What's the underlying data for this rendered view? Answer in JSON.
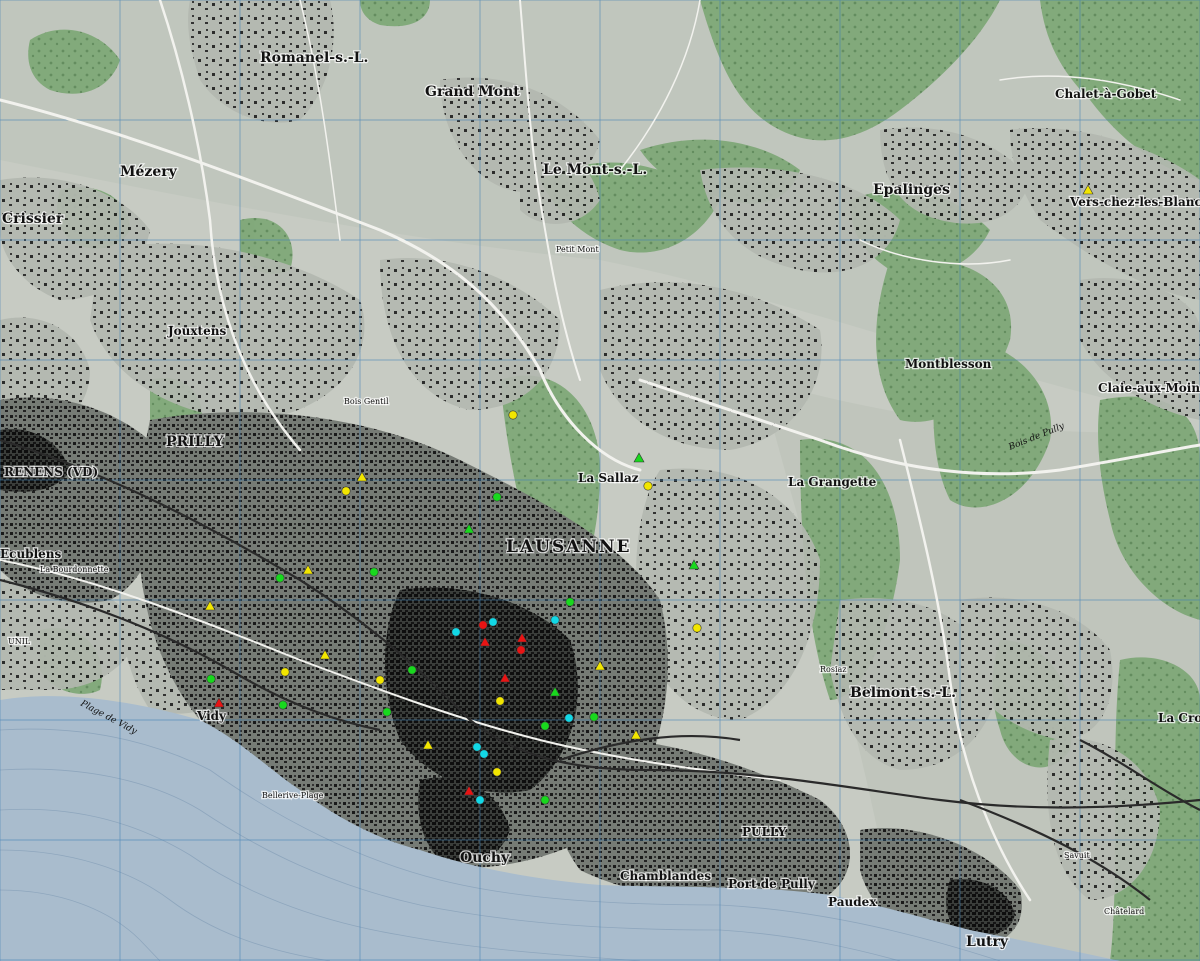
{
  "map": {
    "colors": {
      "lake": "#a9bccd",
      "terrain": "#c7cbc3",
      "forest": "#7fa878",
      "urban": "#6f746f",
      "building": "#111111",
      "grid": "#3f7fb5",
      "road": "#f2f2ee",
      "rail": "#2a2a2a",
      "marker_yellow": "#f2e600",
      "marker_green": "#19d81e",
      "marker_cyan": "#12d8e6",
      "marker_red": "#e81414"
    },
    "places": {
      "lausanne": "LAUSANNE",
      "romanel": "Romanel-s.-L.",
      "le_mont": "Le Mont-s.-L.",
      "grand_mont": "Grand Mont",
      "epalinges": "Epalinges",
      "vers_chez_les_blanc": "Vers-chez-les-Blanc",
      "chalet_a_gobet": "Chalet-à-Gobet",
      "mezery": "Mézery",
      "crissier": "Crissier",
      "jouxtens": "Jouxtens",
      "prilly": "PRILLY",
      "renens": "RENENS (VD)",
      "ecublens": "Ecublens",
      "ouchy": "Ouchy",
      "pully": "PULLY",
      "belmont": "Belmont-s.-L.",
      "lutry": "Lutry",
      "paudex": "Paudex",
      "vidy": "Vidy",
      "monthblesson": "Montblesson",
      "la_sallaz": "La Sallaz",
      "chamblandes": "Chamblandes",
      "port_de_pully": "Port de Pully",
      "plage_de_vidy": "Plage de Vidy",
      "rosiaz": "Rosiaz",
      "savuit": "Savuit",
      "chatelard": "Châtelard",
      "petit_mont": "Petit Mont",
      "la_croix": "La Croix",
      "bellerive": "Bellerive-Plage",
      "la_grangette": "La Grangette",
      "bois_gentil": "Bois Gentil",
      "la_bourdonnette": "La Bourdonnette",
      "unil": "UNIL",
      "bois_du_pully": "Bois de Pully",
      "clairaux": "Claie-aux-Moines"
    }
  }
}
